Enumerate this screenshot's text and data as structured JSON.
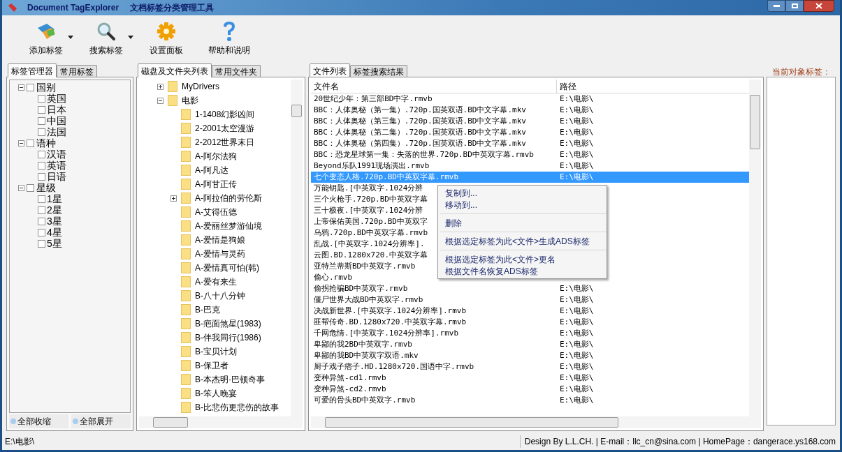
{
  "window": {
    "title": "Document TagExplorer",
    "subtitle": "文档标签分类管理工具"
  },
  "toolbar": [
    {
      "kind": "tag",
      "label": "添加标签",
      "dropdown": true
    },
    {
      "kind": "search",
      "label": "搜索标签",
      "dropdown": true
    },
    {
      "kind": "gear",
      "label": "设置面板",
      "dropdown": false
    },
    {
      "kind": "help",
      "label": "帮助和说明",
      "dropdown": false
    }
  ],
  "tag_panel": {
    "tabs": [
      {
        "label": "标签管理器",
        "selected": true
      },
      {
        "label": "常用标签",
        "selected": false
      }
    ],
    "tree": [
      {
        "label": "国别",
        "checked": false,
        "expanded": true,
        "children": [
          {
            "label": "英国",
            "checked": false
          },
          {
            "label": "日本",
            "checked": false
          },
          {
            "label": "中国",
            "checked": false
          },
          {
            "label": "法国",
            "checked": false
          }
        ]
      },
      {
        "label": "语种",
        "checked": false,
        "expanded": true,
        "children": [
          {
            "label": "汉语",
            "checked": false
          },
          {
            "label": "英语",
            "checked": false
          },
          {
            "label": "日语",
            "checked": false
          }
        ]
      },
      {
        "label": "星级",
        "checked": false,
        "expanded": true,
        "children": [
          {
            "label": "1星",
            "checked": false
          },
          {
            "label": "2星",
            "checked": false
          },
          {
            "label": "3星",
            "checked": false
          },
          {
            "label": "4星",
            "checked": false
          },
          {
            "label": "5星",
            "checked": false
          }
        ]
      }
    ],
    "buttons": [
      "全部收缩",
      "全部展开"
    ]
  },
  "folder_panel": {
    "tabs": [
      {
        "label": "磁盘及文件夹列表",
        "selected": true
      },
      {
        "label": "常用文件夹",
        "selected": false
      }
    ],
    "tree": [
      {
        "label": "MyDrivers",
        "expanded": false
      },
      {
        "label": "电影",
        "expanded": true,
        "children": [
          {
            "label": "1-1408幻影凶间"
          },
          {
            "label": "2-2001太空漫游"
          },
          {
            "label": "2-2012世界末日"
          },
          {
            "label": "A-阿尔法狗"
          },
          {
            "label": "A-阿凡达"
          },
          {
            "label": "A-阿甘正传"
          },
          {
            "label": "A-阿拉伯的劳伦斯",
            "expanded": false
          },
          {
            "label": "A-艾得伍德"
          },
          {
            "label": "A-爱丽丝梦游仙境"
          },
          {
            "label": "A-爱情是狗娘"
          },
          {
            "label": "A-爱情与灵药"
          },
          {
            "label": "A-爱情真可怕(韩)"
          },
          {
            "label": "A-爱有来生"
          },
          {
            "label": "B-八十八分钟"
          },
          {
            "label": "B-巴克"
          },
          {
            "label": "B-疤面煞星(1983)"
          },
          {
            "label": "B-伴我同行(1986)"
          },
          {
            "label": "B-宝贝计划"
          },
          {
            "label": "B-保卫者"
          },
          {
            "label": "B-本杰明·巴顿奇事"
          },
          {
            "label": "B-笨人晚宴"
          },
          {
            "label": "B-比悲伤更悲伤的故事"
          }
        ]
      }
    ]
  },
  "file_panel": {
    "tabs": [
      {
        "label": "文件列表",
        "selected": true
      },
      {
        "label": "标签搜索结果",
        "selected": false
      }
    ],
    "columns": [
      "文件名",
      "路径"
    ],
    "rows": [
      {
        "name": "20世纪少年：第三部BD中字.rmvb",
        "path": "E:\\电影\\",
        "selected": false
      },
      {
        "name": "BBC：人体奥秘（第一集）.720p.国英双语.BD中文字幕.mkv",
        "path": "E:\\电影\\",
        "selected": false
      },
      {
        "name": "BBC：人体奥秘（第三集）.720p.国英双语.BD中文字幕.mkv",
        "path": "E:\\电影\\",
        "selected": false
      },
      {
        "name": "BBC：人体奥秘（第二集）.720p.国英双语.BD中文字幕.mkv",
        "path": "E:\\电影\\",
        "selected": false
      },
      {
        "name": "BBC：人体奥秘（第四集）.720p.国英双语.BD中文字幕.mkv",
        "path": "E:\\电影\\",
        "selected": false
      },
      {
        "name": "BBC：恐龙星球第一集：失落的世界.720p.BD中英双字幕.rmvb",
        "path": "E:\\电影\\",
        "selected": false
      },
      {
        "name": "Beyond乐队1991现场演出.rmvb",
        "path": "E:\\电影\\",
        "selected": false
      },
      {
        "name": "七个变态人格.720p.BD中英双字幕.rmvb",
        "path": "E:\\电影\\",
        "selected": true
      },
      {
        "name": "万能钥匙.[中英双字.1024分辨",
        "selected": false
      },
      {
        "name": "三个火枪手.720p.BD中英双字幕",
        "selected": false
      },
      {
        "name": "三十极夜.[中英双字.1024分辨",
        "selected": false
      },
      {
        "name": "上帝保佑美国.720p.BD中英双字",
        "selected": false
      },
      {
        "name": "乌鸦.720p.BD中英双字幕.rmvb",
        "selected": false
      },
      {
        "name": "乱战.[中英双字.1024分辨率].",
        "selected": false
      },
      {
        "name": "云图.BD.1280x720.中英双字幕",
        "selected": false
      },
      {
        "name": "亚特兰蒂斯BD中英双字.rmvb",
        "selected": false
      },
      {
        "name": "偷心.rmvb",
        "selected": false
      },
      {
        "name": "偷拐抢骗BD中英双字.rmvb",
        "path": "E:\\电影\\",
        "selected": false
      },
      {
        "name": "僵尸世界大战BD中英双字.rmvb",
        "path": "E:\\电影\\",
        "selected": false
      },
      {
        "name": "决战新世界.[中英双字.1024分辨率].rmvb",
        "path": "E:\\电影\\",
        "selected": false
      },
      {
        "name": "匪帮传奇.BD.1280x720.中英双字幕.rmvb",
        "path": "E:\\电影\\",
        "selected": false
      },
      {
        "name": "千网危情.[中英双字.1024分辨率].rmvb",
        "path": "E:\\电影\\",
        "selected": false
      },
      {
        "name": "卑鄙的我2BD中英双字.rmvb",
        "path": "E:\\电影\\",
        "selected": false
      },
      {
        "name": "卑鄙的我BD中英双字双语.mkv",
        "path": "E:\\电影\\",
        "selected": false
      },
      {
        "name": "厨子戏子痞子.HD.1280x720.国语中字.rmvb",
        "path": "E:\\电影\\",
        "selected": false
      },
      {
        "name": "变种异煞-cd1.rmvb",
        "path": "E:\\电影\\",
        "selected": false
      },
      {
        "name": "变种异煞-cd2.rmvb",
        "path": "E:\\电影\\",
        "selected": false
      },
      {
        "name": "可爱的骨头BD中英双字.rmvb",
        "path": "E:\\电影\\",
        "selected": false
      }
    ]
  },
  "context_menu": [
    {
      "kind": "item",
      "label": "复制到..."
    },
    {
      "kind": "item",
      "label": "移动到..."
    },
    {
      "kind": "separator"
    },
    {
      "kind": "item",
      "label": "删除"
    },
    {
      "kind": "separator"
    },
    {
      "kind": "item",
      "label": "根据选定标签为此<文件>生成ADS标签"
    },
    {
      "kind": "separator"
    },
    {
      "kind": "item",
      "label": "根据选定标签为此<文件>更名"
    },
    {
      "kind": "item",
      "label": "根据文件名恢复ADS标签"
    }
  ],
  "tag_box": {
    "title": "当前对象标签："
  },
  "status_bar": {
    "path": "E:\\电影\\",
    "credits": "Design By L.L.CH. | E-mail：llc_cn@sina.com | HomePage：dangerace.ys168.com"
  }
}
